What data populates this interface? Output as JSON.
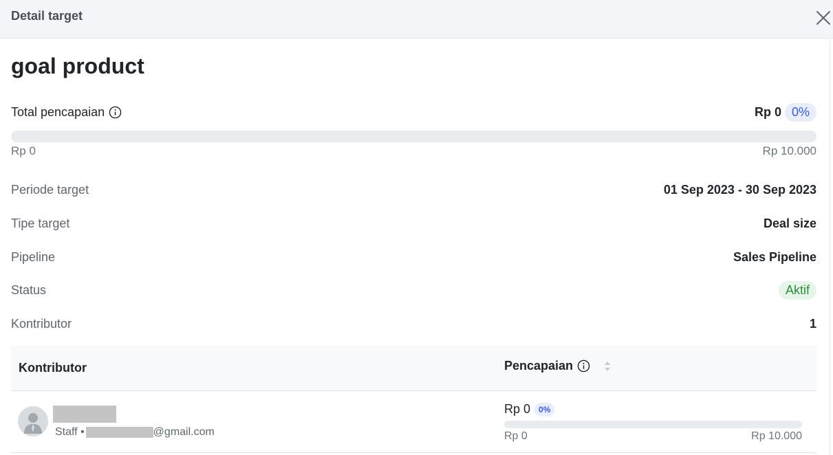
{
  "header": {
    "title": "Detail target"
  },
  "target": {
    "name": "goal product",
    "total_label": "Total pencapaian",
    "total_value": "Rp 0",
    "total_percent": "0%",
    "progress_fraction": 0,
    "range_min": "Rp 0",
    "range_max": "Rp 10.000"
  },
  "details": {
    "period_label": "Periode target",
    "period_value": "01 Sep 2023 - 30 Sep 2023",
    "type_label": "Tipe target",
    "type_value": "Deal size",
    "pipeline_label": "Pipeline",
    "pipeline_value": "Sales Pipeline",
    "status_label": "Status",
    "status_value": "Aktif",
    "contributor_label": "Kontributor",
    "contributor_count": "1"
  },
  "table": {
    "columns": {
      "contributor": "Kontributor",
      "achievement": "Pencapaian"
    },
    "rows": [
      {
        "role_prefix": "Staff •",
        "email_suffix": "@gmail.com",
        "amount": "Rp 0",
        "percent": "0%",
        "progress_fraction": 0,
        "range_min": "Rp 0",
        "range_max": "Rp 10.000"
      }
    ]
  },
  "colors": {
    "accent": "#3a5bc7",
    "status_green": "#2e8b3e",
    "header_bg": "#f3f5f8"
  },
  "icons": {
    "close": "close-icon",
    "info": "info-icon",
    "sort": "sort-icon",
    "avatar": "user-avatar-icon"
  }
}
